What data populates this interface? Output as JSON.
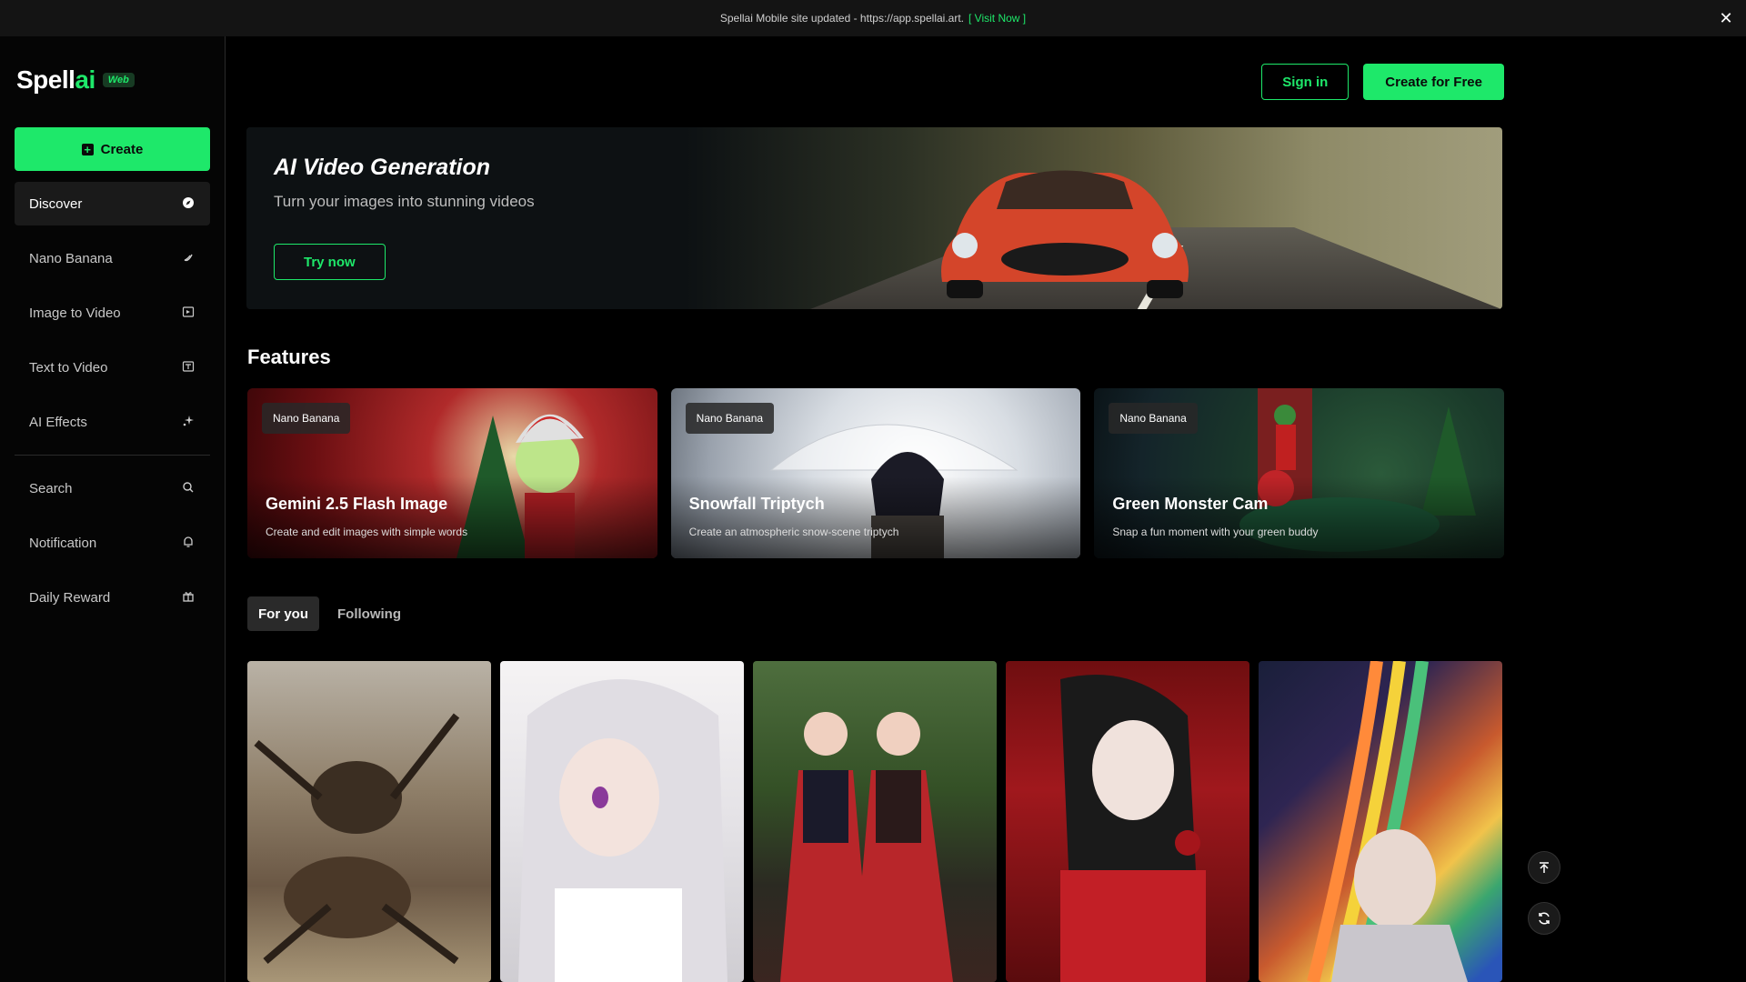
{
  "announcement": {
    "text": "Spellai Mobile site updated - https://app.spellai.art.",
    "link": "[ Visit Now ]",
    "close_icon": "close-icon"
  },
  "brand": {
    "name_part1": "Spell",
    "name_part2": "ai",
    "badge": "Web",
    "accent": "#1ee86a"
  },
  "sidebar": {
    "create_label": "Create",
    "items": [
      {
        "label": "Discover",
        "icon": "compass-icon",
        "active": true
      },
      {
        "label": "Nano Banana",
        "icon": "banana-icon"
      },
      {
        "label": "Image to Video",
        "icon": "image-video-icon"
      },
      {
        "label": "Text to Video",
        "icon": "text-video-icon"
      },
      {
        "label": "AI Effects",
        "icon": "sparkle-icon"
      }
    ],
    "secondary": [
      {
        "label": "Search",
        "icon": "search-icon"
      },
      {
        "label": "Notification",
        "icon": "bell-icon"
      },
      {
        "label": "Daily Reward",
        "icon": "gift-icon"
      }
    ]
  },
  "header": {
    "sign_in": "Sign in",
    "create_free": "Create for Free"
  },
  "hero": {
    "title": "AI Video Generation",
    "subtitle": "Turn your images into stunning videos",
    "cta": "Try now"
  },
  "features": {
    "title": "Features",
    "cards": [
      {
        "tag": "Nano Banana",
        "title": "Gemini 2.5 Flash Image",
        "subtitle": "Create and edit images with simple words"
      },
      {
        "tag": "Nano Banana",
        "title": "Snowfall Triptych",
        "subtitle": "Create an atmospheric snow-scene triptych"
      },
      {
        "tag": "Nano Banana",
        "title": "Green Monster Cam",
        "subtitle": "Snap a fun moment with your green buddy"
      }
    ]
  },
  "tabs": [
    {
      "label": "For you",
      "active": true
    },
    {
      "label": "Following"
    }
  ],
  "floating": {
    "top_icon": "scroll-top-icon",
    "refresh_icon": "refresh-icon"
  }
}
